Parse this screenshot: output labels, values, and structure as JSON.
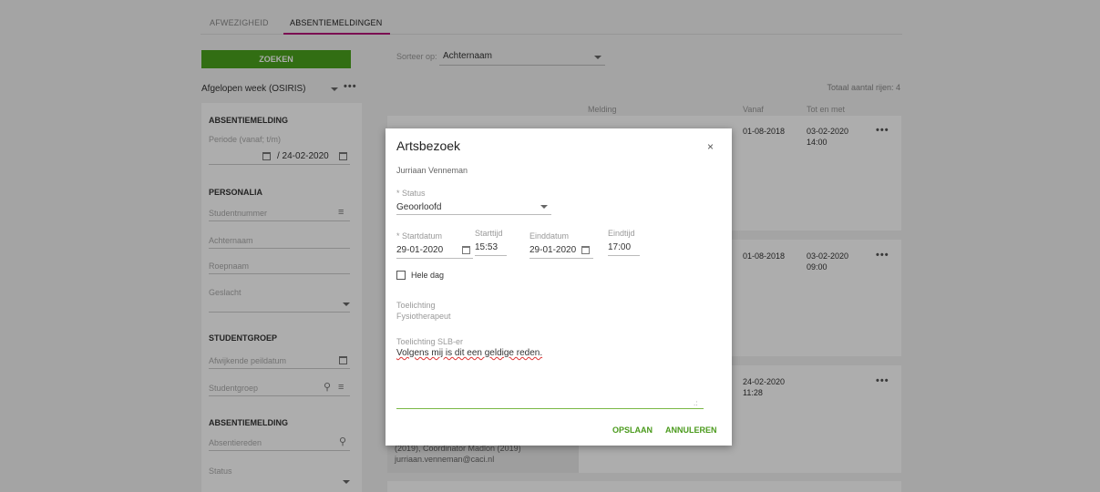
{
  "tabs": [
    {
      "label": "AFWEZIGHEID"
    },
    {
      "label": "ABSENTIEMELDINGEN"
    }
  ],
  "sidebar": {
    "search_button": "ZOEKEN",
    "period_select": "Afgelopen week (OSIRIS)",
    "sections": {
      "absentiemelding": "ABSENTIEMELDING",
      "personalia": "PERSONALIA",
      "studentgroep": "STUDENTGROEP",
      "absentiemelding2": "ABSENTIEMELDING"
    },
    "fields": {
      "periode_label": "Periode (vanaf; t/m)",
      "periode_value": "/ 24-02-2020",
      "studentnummer": "Studentnummer",
      "achternaam": "Achternaam",
      "roepnaam": "Roepnaam",
      "geslacht": "Geslacht",
      "peildatum": "Afwijkende peildatum",
      "studentgroep": "Studentgroep",
      "absentiereden": "Absentiereden",
      "status": "Status"
    }
  },
  "sort": {
    "label": "Sorteer op:",
    "value": "Achternaam"
  },
  "total_rows": "Totaal aantal rijen: 4",
  "columns": {
    "melding": "Melding",
    "vanaf": "Vanaf",
    "tot": "Tot en met"
  },
  "rows": [
    {
      "vanaf": "01-08-2018",
      "tot_date": "03-02-2020",
      "tot_time": "14:00"
    },
    {
      "vanaf": "01-08-2018",
      "tot_date": "03-02-2020",
      "tot_time": "09:00"
    },
    {
      "vanaf_date": "24-02-2020",
      "vanaf_time": "11:28",
      "email": "jurriaan.venneman@caci.nl",
      "extra": "(2019), Coordinator Madlon (2019)"
    }
  ],
  "dialog": {
    "title": "Artsbezoek",
    "close": "×",
    "student": "Jurriaan Venneman",
    "status_label": "* Status",
    "status_value": "Geoorloofd",
    "startdatum_label": "* Startdatum",
    "startdatum_value": "29-01-2020",
    "starttijd_label": "Starttijd",
    "starttijd_value": "15:53",
    "einddatum_label": "Einddatum",
    "einddatum_value": "29-01-2020",
    "eindtijd_label": "Eindtijd",
    "eindtijd_value": "17:00",
    "heledag_label": "Hele dag",
    "toelichting_label": "Toelichting",
    "toelichting_value": "Fysiotherapeut",
    "slb_label": "Toelichting SLB-er",
    "slb_value": "Volgens mij is dit een geldige reden.",
    "save": "OPSLAAN",
    "cancel": "ANNULEREN"
  }
}
